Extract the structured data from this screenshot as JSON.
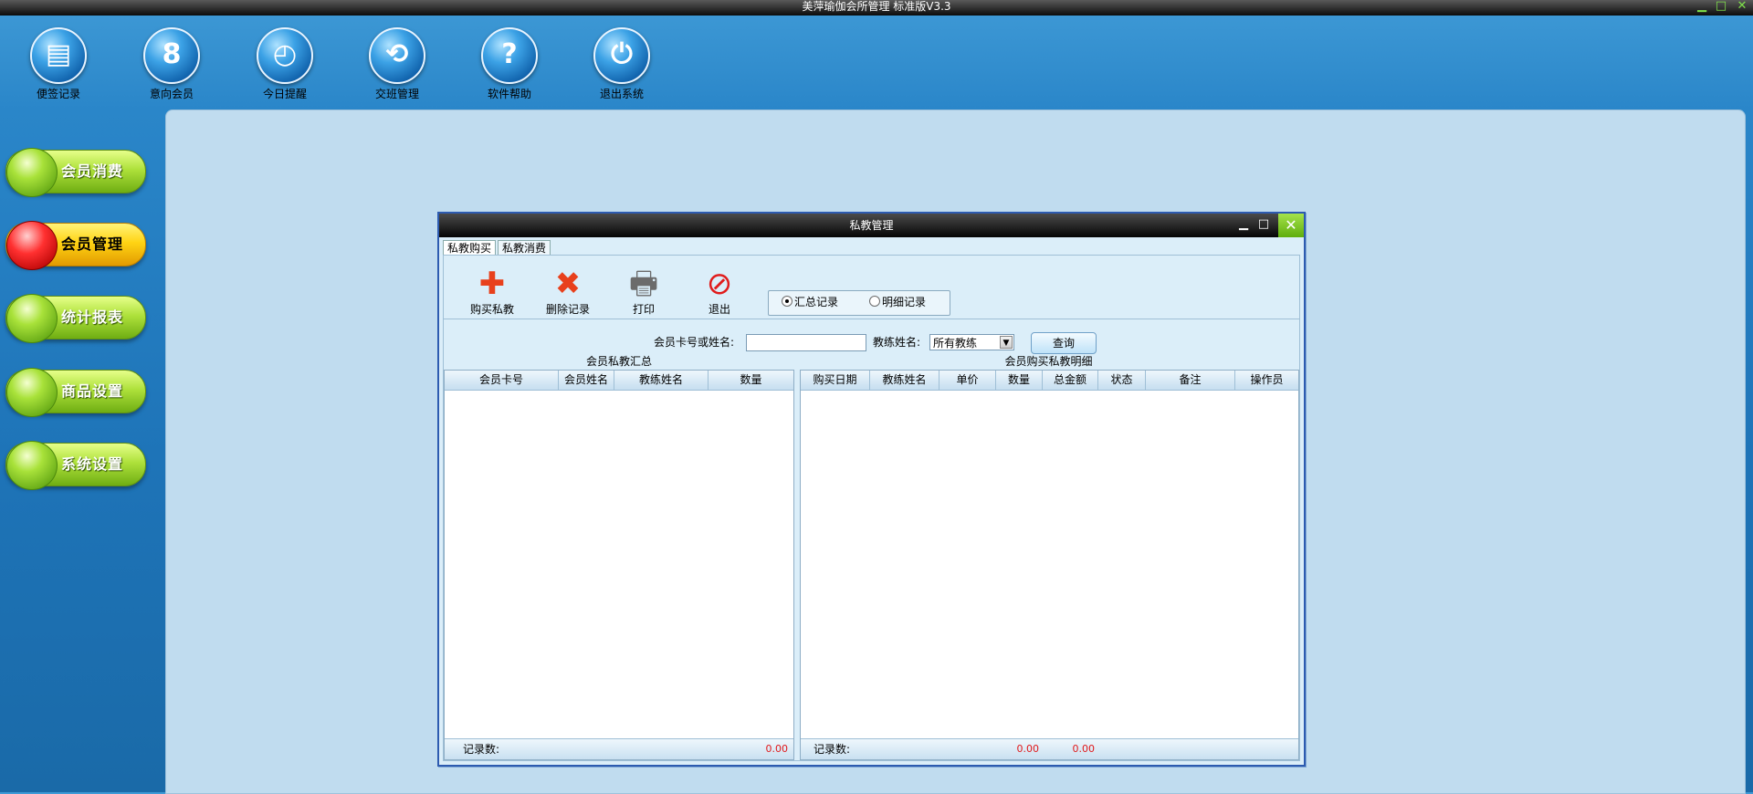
{
  "app": {
    "title": "美萍瑜伽会所管理 标准版V3.3"
  },
  "window_controls": {
    "minimize": "▁",
    "maximize": "□",
    "close": "✕"
  },
  "top_toolbar": [
    {
      "label": "便签记录",
      "icon": "notepad-icon",
      "glyph": "▤"
    },
    {
      "label": "意向会员",
      "icon": "member-icon",
      "glyph": "8"
    },
    {
      "label": "今日提醒",
      "icon": "clock-icon",
      "glyph": "◴"
    },
    {
      "label": "交班管理",
      "icon": "refresh-icon",
      "glyph": "⟲"
    },
    {
      "label": "软件帮助",
      "icon": "help-icon",
      "glyph": "?"
    },
    {
      "label": "退出系统",
      "icon": "power-icon",
      "glyph": "⏻"
    }
  ],
  "side_nav": [
    {
      "label": "会员消费",
      "active": false
    },
    {
      "label": "会员管理",
      "active": true
    },
    {
      "label": "统计报表",
      "active": false
    },
    {
      "label": "商品设置",
      "active": false
    },
    {
      "label": "系统设置",
      "active": false
    }
  ],
  "dialog": {
    "title": "私教管理",
    "tabs": [
      {
        "label": "私教购买",
        "active": true
      },
      {
        "label": "私教消费",
        "active": false
      }
    ],
    "actions": [
      {
        "label": "购买私教",
        "icon": "plus-icon",
        "glyph": "✚",
        "color": "#e8401c"
      },
      {
        "label": "删除记录",
        "icon": "delete-icon",
        "glyph": "✖",
        "color": "#e8401c"
      },
      {
        "label": "打印",
        "icon": "printer-icon",
        "glyph": "🖶",
        "color": "#6b6b6b"
      },
      {
        "label": "退出",
        "icon": "no-entry-icon",
        "glyph": "⊘",
        "color": "#e01c1c"
      }
    ],
    "view_mode": {
      "options": [
        {
          "label": "汇总记录",
          "selected": true
        },
        {
          "label": "明细记录",
          "selected": false
        }
      ]
    },
    "search": {
      "card_label": "会员卡号或姓名:",
      "card_value": "",
      "coach_label": "教练姓名:",
      "coach_value": "所有教练",
      "query_label": "查询"
    },
    "summary_grid": {
      "caption": "会员私教汇总",
      "columns": [
        "会员卡号",
        "会员姓名",
        "教练姓名",
        "数量"
      ],
      "footer_label": "记录数:",
      "footer_total": "0.00"
    },
    "detail_grid": {
      "caption": "会员购买私教明细",
      "columns": [
        "购买日期",
        "教练姓名",
        "单价",
        "数量",
        "总金额",
        "状态",
        "备注",
        "操作员"
      ],
      "footer_label": "记录数:",
      "footer_qty": "0.00",
      "footer_amount": "0.00"
    }
  }
}
